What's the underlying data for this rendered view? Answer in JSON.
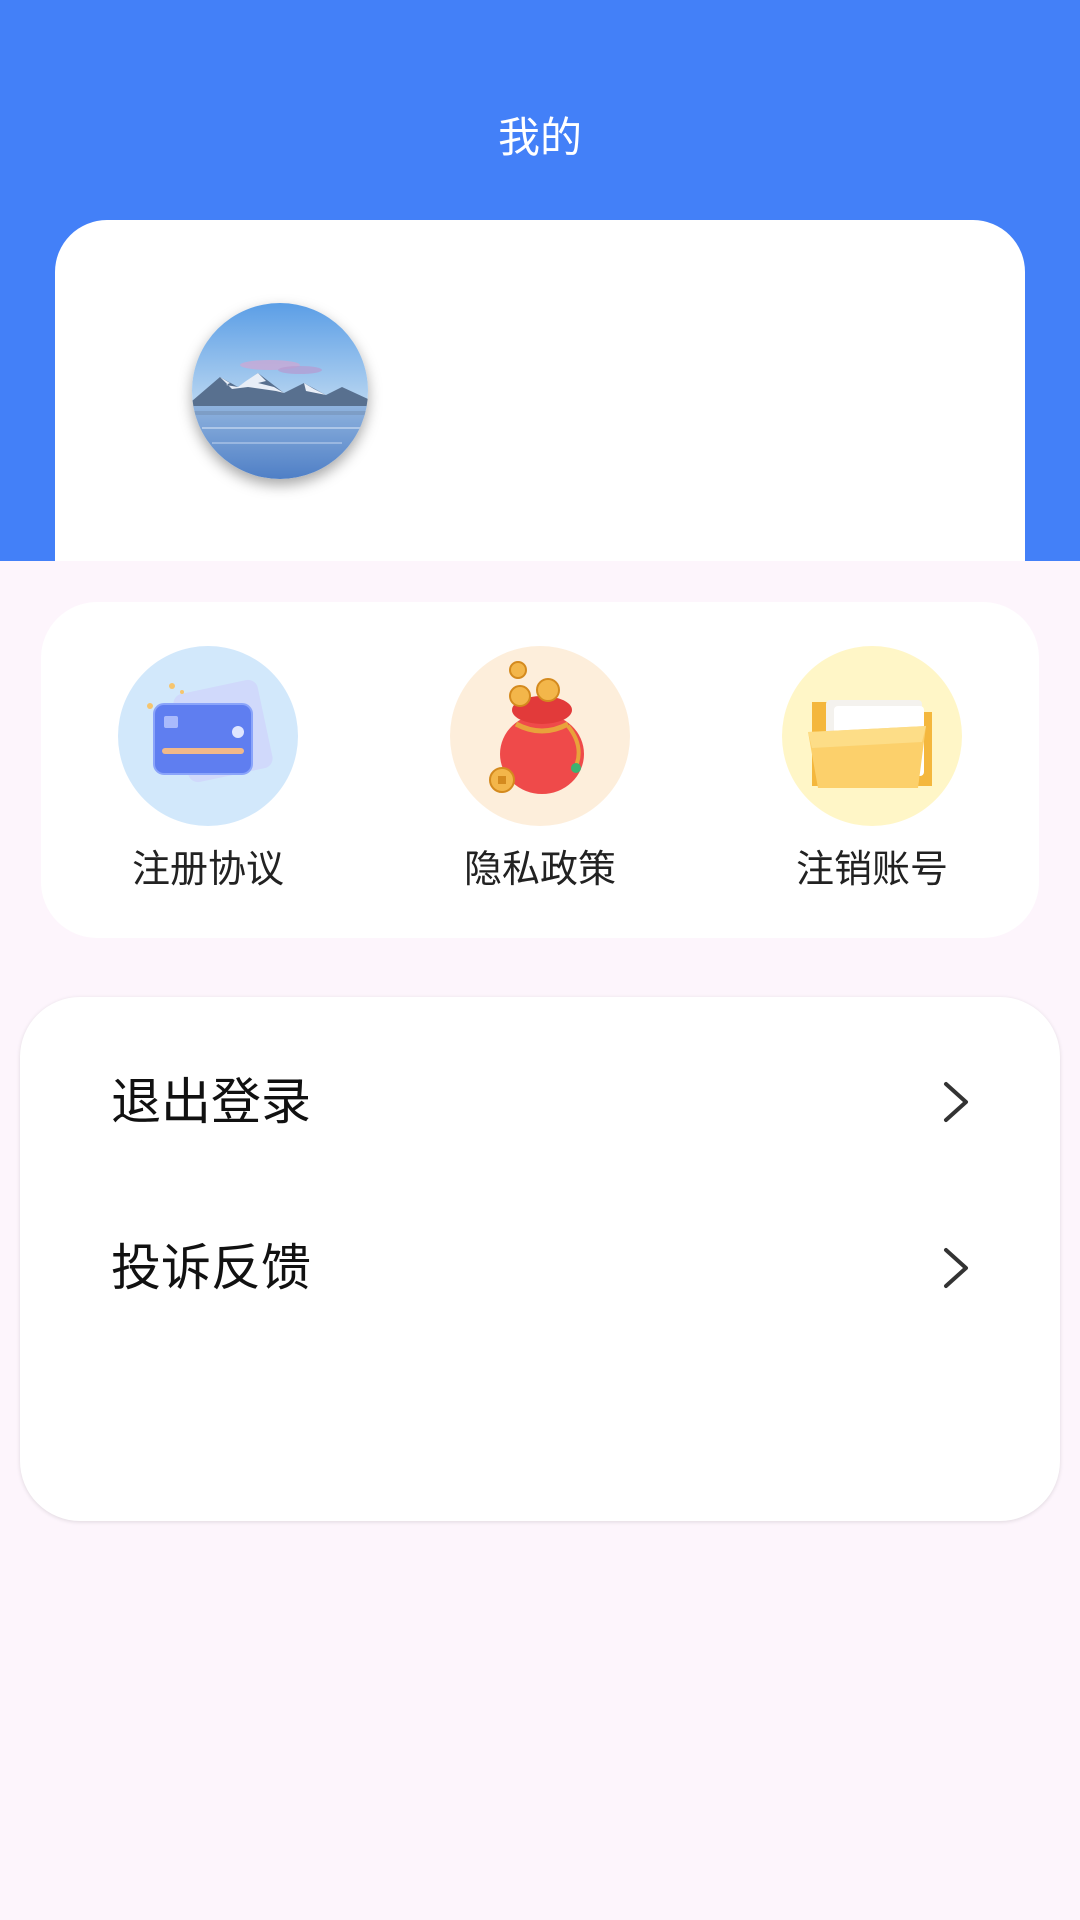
{
  "header": {
    "title": "我的",
    "background_color": "#4380f8"
  },
  "profile": {
    "avatar_icon": "landscape-avatar"
  },
  "shortcuts": [
    {
      "label": "注册协议",
      "icon": "credit-card-icon",
      "circle_color": "#d2e8fb"
    },
    {
      "label": "隐私政策",
      "icon": "money-bag-icon",
      "circle_color": "#fdeedb"
    },
    {
      "label": "注销账号",
      "icon": "folder-icon",
      "circle_color": "#fff6c7"
    }
  ],
  "menu": {
    "items": [
      {
        "label": "退出登录",
        "icon": "chevron-right-icon"
      },
      {
        "label": "投诉反馈",
        "icon": "chevron-right-icon"
      }
    ]
  },
  "colors": {
    "page_background": "#fdf5fc",
    "card_background": "#ffffff",
    "text_primary": "#111111"
  }
}
